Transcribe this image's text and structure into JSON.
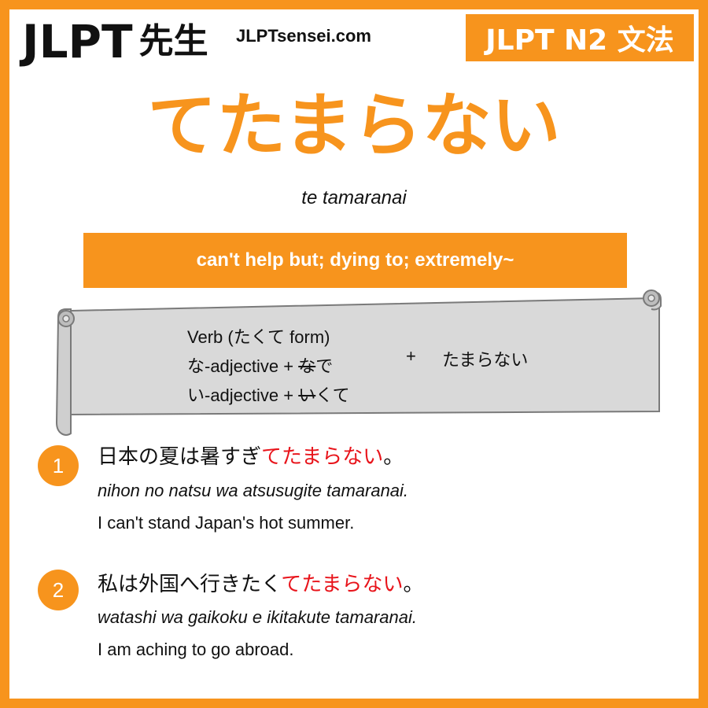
{
  "header": {
    "logo_latin": "JLPT",
    "logo_kanji": "先生",
    "site_url": "JLPTsensei.com",
    "level_badge": "JLPT N2 文法"
  },
  "grammar": {
    "title": "てたまらない",
    "romaji": "te tamaranai",
    "meaning": "can't help but; dying to; extremely~"
  },
  "pattern": {
    "lines": [
      {
        "prefix": "Verb (たくて form)",
        "struck": "",
        "suffix": ""
      },
      {
        "prefix": "な-adjective + ",
        "struck": "な",
        "suffix": "で"
      },
      {
        "prefix": "い-adjective + ",
        "struck": "い",
        "suffix": "くて"
      }
    ],
    "plus": "+",
    "result": "たまらない"
  },
  "examples": [
    {
      "number": "1",
      "jp_before": "日本の夏は暑すぎ",
      "jp_highlight": "てたまらない",
      "jp_after": "。",
      "romaji": "nihon no natsu wa atsusugite tamaranai.",
      "english": "I can't stand Japan's hot summer."
    },
    {
      "number": "2",
      "jp_before": "私は外国へ行きたく",
      "jp_highlight": "てたまらない",
      "jp_after": "。",
      "romaji": "watashi wa gaikoku e ikitakute tamaranai.",
      "english": "I am aching to go abroad."
    }
  ],
  "colors": {
    "accent": "#f7941d",
    "highlight": "#e8141b",
    "scroll_fill": "#d9d9d9"
  }
}
